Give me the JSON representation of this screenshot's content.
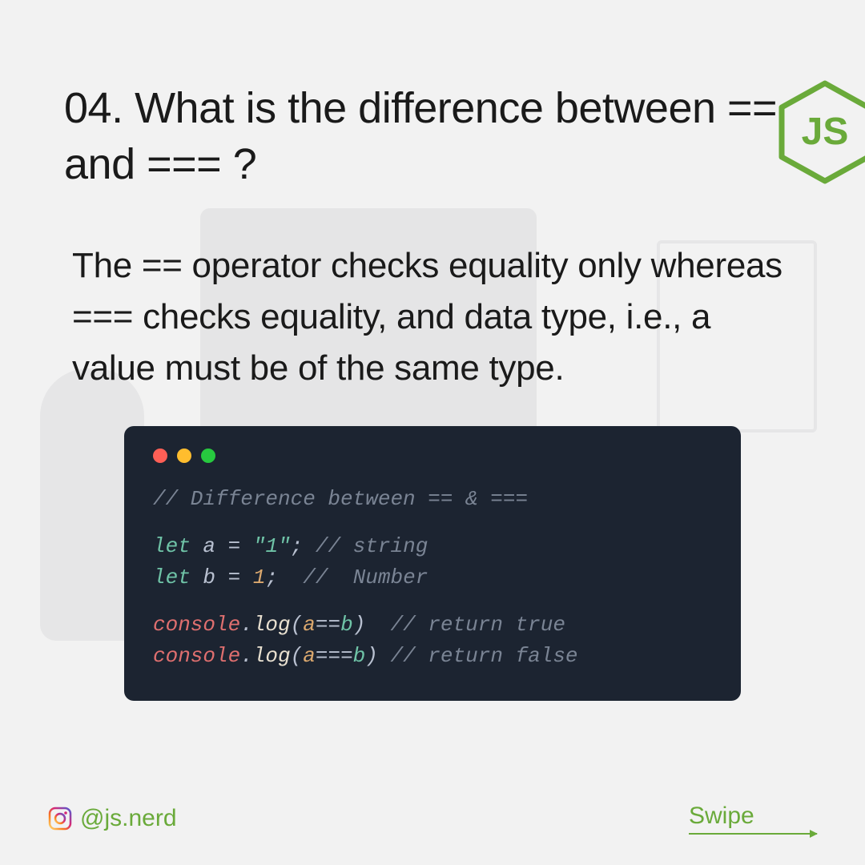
{
  "question": "04. What is the difference between == and === ?",
  "answer": "The == operator checks equality only whereas === checks equality, and data type, i.e., a value must be of the same type.",
  "code": {
    "comment_header": "// Difference between == & ===",
    "line1": {
      "keyword": "let",
      "var": "a",
      "op": "=",
      "value": "\"1\"",
      "semi": ";",
      "comment": "// string"
    },
    "line2": {
      "keyword": "let",
      "var": "b",
      "op": "=",
      "value": "1",
      "semi": ";",
      "comment": "//  Number"
    },
    "line3": {
      "obj": "console",
      "dot": ".",
      "method": "log",
      "open": "(",
      "a": "a",
      "op": "==",
      "b": "b",
      "close": ")",
      "comment": "// return true"
    },
    "line4": {
      "obj": "console",
      "dot": ".",
      "method": "log",
      "open": "(",
      "a": "a",
      "op": "===",
      "b": "b",
      "close": ")",
      "comment": "// return false"
    }
  },
  "footer": {
    "handle": "@js.nerd",
    "swipe": "Swipe"
  },
  "logo_text": "JS"
}
